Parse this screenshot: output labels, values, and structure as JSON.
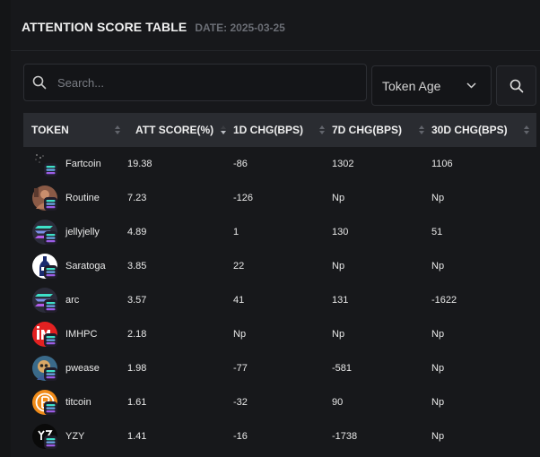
{
  "header": {
    "title": "ATTENTION SCORE TABLE",
    "date": "DATE: 2025-03-25"
  },
  "search": {
    "placeholder": "Search...",
    "value": ""
  },
  "filter": {
    "selected": "Token Age"
  },
  "table": {
    "columns": [
      "TOKEN",
      "ATT SCORE(%)",
      "1D CHG(BPS)",
      "7D CHG(BPS)",
      "30D CHG(BPS)"
    ],
    "sorted_column": "ATT SCORE(%)",
    "sort_direction": "descending",
    "rows": [
      {
        "token": "Fartcoin",
        "avatar": "fartcoin-avatar",
        "att": "19.38",
        "d1": "-86",
        "d7": "1302",
        "d30": "1106"
      },
      {
        "token": "Routine",
        "avatar": "routine-avatar",
        "att": "7.23",
        "d1": "-126",
        "d7": "Np",
        "d30": "Np"
      },
      {
        "token": "jellyjelly",
        "avatar": "solana-avatar",
        "att": "4.89",
        "d1": "1",
        "d7": "130",
        "d30": "51"
      },
      {
        "token": "Saratoga",
        "avatar": "saratoga-avatar",
        "att": "3.85",
        "d1": "22",
        "d7": "Np",
        "d30": "Np"
      },
      {
        "token": "arc",
        "avatar": "solana-avatar",
        "att": "3.57",
        "d1": "41",
        "d7": "131",
        "d30": "-1622"
      },
      {
        "token": "IMHPC",
        "avatar": "imhpc-avatar",
        "att": "2.18",
        "d1": "Np",
        "d7": "Np",
        "d30": "Np"
      },
      {
        "token": "pwease",
        "avatar": "pwease-avatar",
        "att": "1.98",
        "d1": "-77",
        "d7": "-581",
        "d30": "Np"
      },
      {
        "token": "titcoin",
        "avatar": "titcoin-avatar",
        "att": "1.61",
        "d1": "-32",
        "d7": "90",
        "d30": "Np"
      },
      {
        "token": "YZY",
        "avatar": "yzy-avatar",
        "att": "1.41",
        "d1": "-16",
        "d7": "-1738",
        "d30": "Np"
      }
    ]
  },
  "colors": {
    "background": "#17181b",
    "header_row": "#2a2c31",
    "date_text": "#6b6e75",
    "solana_teal": "#3ee0c8",
    "solana_purple": "#9b5de5"
  },
  "icons": [
    "search-icon",
    "chevron-down-icon",
    "sort-arrows-icon",
    "solana-badge-icon"
  ]
}
